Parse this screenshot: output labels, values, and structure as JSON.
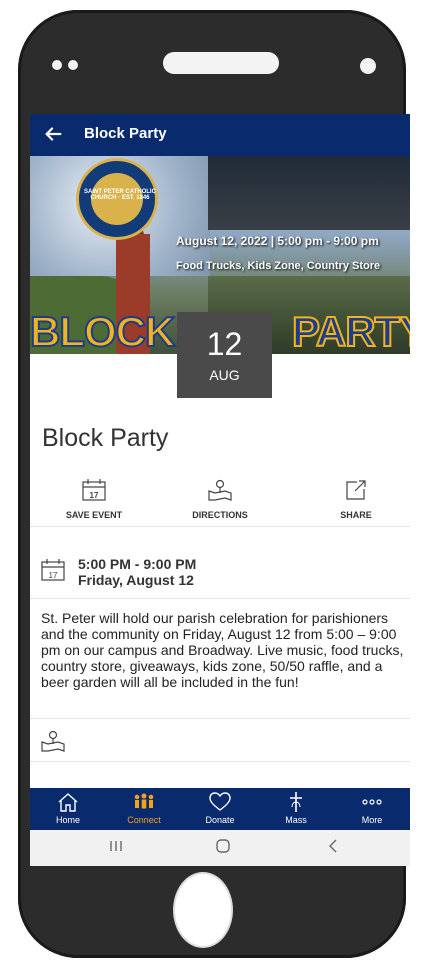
{
  "app": {
    "back_icon": "arrow-left-icon",
    "title": "Block Party"
  },
  "hero": {
    "seal_text": "SAINT PETER CATHOLIC CHURCH · EST. 1846",
    "date_line": "August 12, 2022 | 5:00 pm - 9:00 pm",
    "sub_line": "Food Trucks, Kids Zone, Country Store",
    "word_left": "BLOCK",
    "word_right": "PARTY"
  },
  "date_badge": {
    "day": "12",
    "month": "AUG"
  },
  "event": {
    "title": "Block Party",
    "actions": [
      {
        "label": "SAVE EVENT",
        "icon": "calendar-icon"
      },
      {
        "label": "DIRECTIONS",
        "icon": "map-pin-icon"
      },
      {
        "label": "SHARE",
        "icon": "share-icon"
      }
    ],
    "time": "5:00 PM - 9:00 PM",
    "date": "Friday, August 12",
    "description": "St. Peter will hold our parish celebration for parishioners and the community on Friday, August 12 from 5:00 – 9:00 pm on our campus and Broadway. Live music, food trucks, country store, giveaways, kids zone, 50/50 raffle, and a beer garden will all be included in the fun!"
  },
  "calendar_icon_day": "17",
  "nav": [
    {
      "label": "Home",
      "icon": "home-icon"
    },
    {
      "label": "Connect",
      "icon": "people-icon",
      "active": true
    },
    {
      "label": "Donate",
      "icon": "heart-icon"
    },
    {
      "label": "Mass",
      "icon": "cross-icon"
    },
    {
      "label": "More",
      "icon": "more-icon"
    }
  ],
  "colors": {
    "primary": "#0a2a6e",
    "accent": "#f3a11a"
  }
}
